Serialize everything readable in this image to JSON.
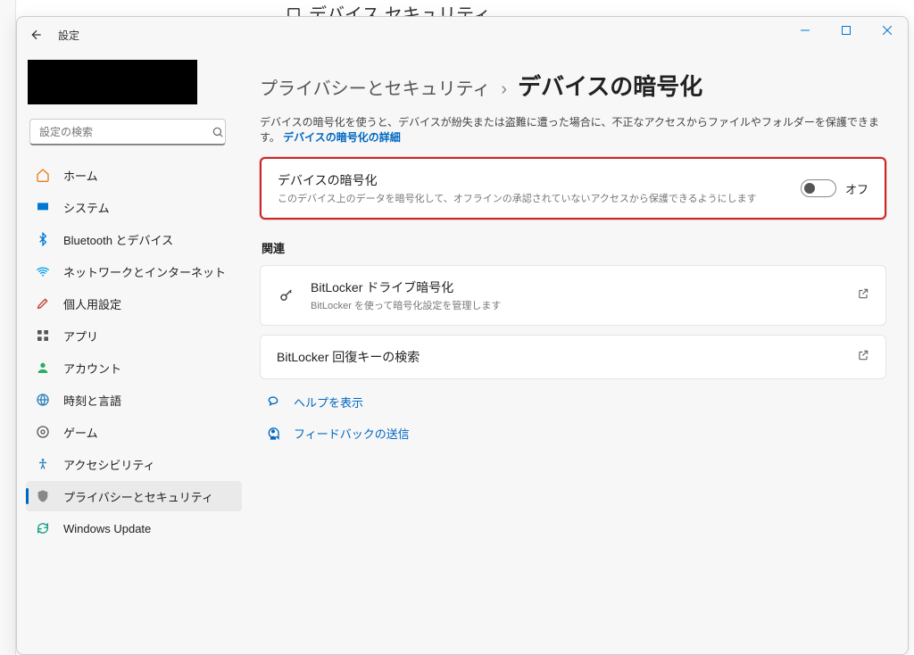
{
  "bg_title": "デバイス セキュリティ",
  "titlebar": {
    "app_name": "設定"
  },
  "search": {
    "placeholder": "設定の検索"
  },
  "sidebar": {
    "items": [
      {
        "label": "ホーム"
      },
      {
        "label": "システム"
      },
      {
        "label": "Bluetooth とデバイス"
      },
      {
        "label": "ネットワークとインターネット"
      },
      {
        "label": "個人用設定"
      },
      {
        "label": "アプリ"
      },
      {
        "label": "アカウント"
      },
      {
        "label": "時刻と言語"
      },
      {
        "label": "ゲーム"
      },
      {
        "label": "アクセシビリティ"
      },
      {
        "label": "プライバシーとセキュリティ"
      },
      {
        "label": "Windows Update"
      }
    ]
  },
  "breadcrumb": {
    "parent": "プライバシーとセキュリティ",
    "current": "デバイスの暗号化"
  },
  "description": {
    "text": "デバイスの暗号化を使うと、デバイスが紛失または盗難に遭った場合に、不正なアクセスからファイルやフォルダーを保護できます。",
    "link": "デバイスの暗号化の詳細"
  },
  "encryption_card": {
    "title": "デバイスの暗号化",
    "subtitle": "このデバイス上のデータを暗号化して、オフラインの承認されていないアクセスから保護できるようにします",
    "state_label": "オフ"
  },
  "sections": {
    "related": "関連"
  },
  "related": {
    "bitlocker": {
      "title": "BitLocker ドライブ暗号化",
      "subtitle": "BitLocker を使って暗号化設定を管理します"
    },
    "recovery": {
      "title": "BitLocker 回復キーの検索"
    }
  },
  "links": {
    "help": "ヘルプを表示",
    "feedback": "フィードバックの送信"
  }
}
